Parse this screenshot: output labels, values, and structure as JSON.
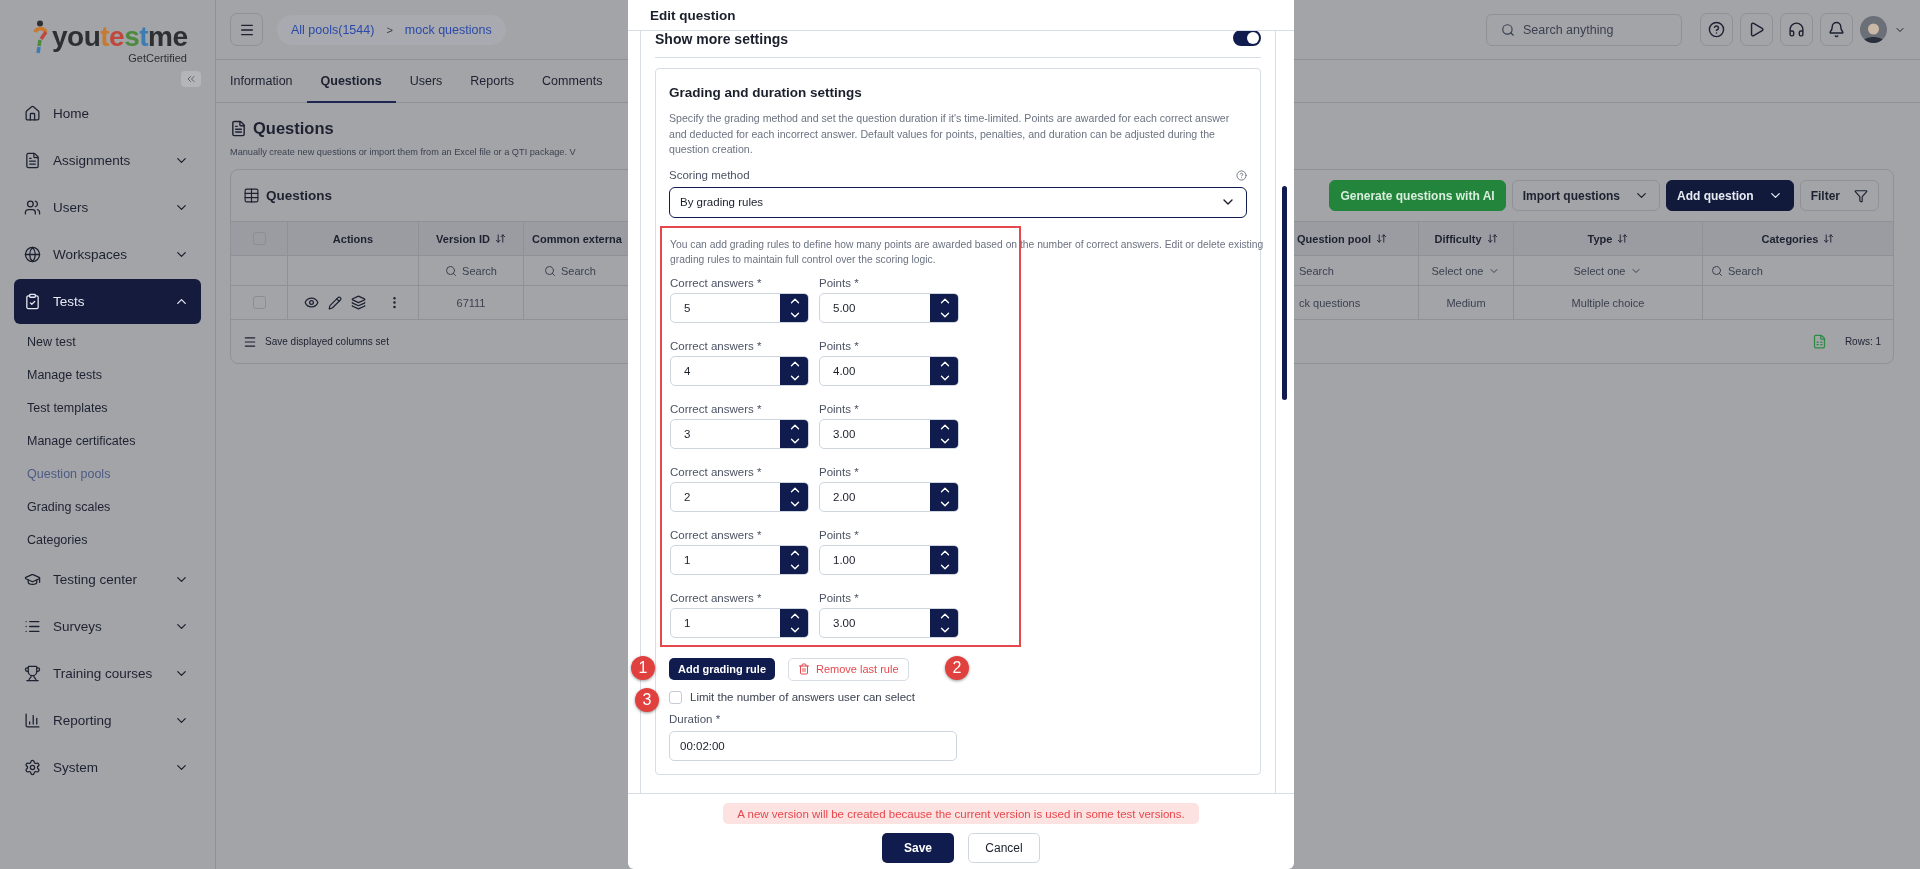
{
  "sidebar": {
    "logo": {
      "parts": [
        {
          "text": "you",
          "color": "#2e2f33"
        },
        {
          "text": "t",
          "color": "#c8782f"
        },
        {
          "text": "e",
          "color": "#c0473c"
        },
        {
          "text": "s",
          "color": "#4d8a3f"
        },
        {
          "text": "t",
          "color": "#3b7db3"
        },
        {
          "text": "me",
          "color": "#2e2f33"
        }
      ],
      "tagline": "GetCertified"
    },
    "items": [
      {
        "kind": "link",
        "label": "Home",
        "selected": false
      },
      {
        "kind": "group",
        "label": "Assignments",
        "expanded": false,
        "selected": false
      },
      {
        "kind": "group",
        "label": "Users",
        "expanded": false,
        "selected": false
      },
      {
        "kind": "group",
        "label": "Workspaces",
        "expanded": false,
        "selected": false
      },
      {
        "kind": "group",
        "label": "Tests",
        "expanded": true,
        "selected": true,
        "children": [
          {
            "label": "New test",
            "selected": false
          },
          {
            "label": "Manage tests",
            "selected": false
          },
          {
            "label": "Test templates",
            "selected": false
          },
          {
            "label": "Manage certificates",
            "selected": false
          },
          {
            "label": "Question pools",
            "selected": true
          },
          {
            "label": "Grading scales",
            "selected": false
          },
          {
            "label": "Categories",
            "selected": false
          }
        ]
      },
      {
        "kind": "group",
        "label": "Testing center",
        "expanded": false,
        "selected": false
      },
      {
        "kind": "group",
        "label": "Surveys",
        "expanded": false,
        "selected": false
      },
      {
        "kind": "group",
        "label": "Training courses",
        "expanded": false,
        "selected": false
      },
      {
        "kind": "group",
        "label": "Reporting",
        "expanded": false,
        "selected": false
      },
      {
        "kind": "group",
        "label": "System",
        "expanded": false,
        "selected": false
      }
    ]
  },
  "header": {
    "breadcrumbs": [
      "All pools(1544)",
      "mock questions"
    ],
    "separator": ">",
    "search": {
      "placeholder": "Search anything"
    }
  },
  "tabs": [
    {
      "label": "Information",
      "selected": false
    },
    {
      "label": "Questions",
      "selected": true
    },
    {
      "label": "Users",
      "selected": false
    },
    {
      "label": "Reports",
      "selected": false
    },
    {
      "label": "Comments",
      "selected": false
    }
  ],
  "page": {
    "title": "Questions",
    "description": "Manually create new questions or import them from an Excel file or a QTI package. V"
  },
  "card": {
    "title": "Questions",
    "buttons": [
      {
        "kind": "ai",
        "label": "Generate questions with AI"
      },
      {
        "kind": "dropdown",
        "label": "Import questions"
      },
      {
        "kind": "primary",
        "label": "Add question"
      },
      {
        "kind": "filter",
        "label": "Filter"
      }
    ]
  },
  "table": {
    "select_all": {
      "checked": false
    },
    "columns": [
      {
        "label": "Actions",
        "sortable": false
      },
      {
        "label": "Version ID",
        "sortable": true
      },
      {
        "label": "Common externa",
        "sortable": false
      },
      {
        "label": "Question pool",
        "sortable": true
      },
      {
        "label": "Difficulty",
        "sortable": true
      },
      {
        "label": "Type",
        "sortable": true
      },
      {
        "label": "Categories",
        "sortable": true
      }
    ],
    "filters": [
      {
        "kind": "none"
      },
      {
        "kind": "search",
        "placeholder": "Search"
      },
      {
        "kind": "search",
        "placeholder": "Search"
      },
      {
        "kind": "text",
        "placeholder": "Search"
      },
      {
        "kind": "select",
        "placeholder": "Select one"
      },
      {
        "kind": "select",
        "placeholder": "Select one"
      },
      {
        "kind": "search",
        "placeholder": "Search"
      }
    ],
    "rows": [
      {
        "checked": false,
        "version_id": "67111",
        "question_pool": "ck questions",
        "difficulty": "Medium",
        "type": "Multiple choice"
      }
    ],
    "save_columns": "Save displayed columns set",
    "row_count": "Rows: 1"
  },
  "modal": {
    "title": "Edit question",
    "show_more": {
      "label": "Show more settings",
      "on": true
    },
    "section": {
      "title": "Grading and duration settings",
      "description": "Specify the grading method and set the question duration if it's time-limited. Points are awarded for each correct answer and deducted for each incorrect answer. Default values for points, penalties, and duration can be adjusted during the question creation.",
      "scoring": {
        "label": "Scoring method",
        "value": "By grading rules"
      },
      "rules_intro": "You can add grading rules to define how many points are awarded based on the number of correct answers. Edit or delete existing grading rules to maintain full control over the scoring logic.",
      "rules": [
        {
          "correct_label": "Correct answers *",
          "correct": "5",
          "points_label": "Points *",
          "points": "5.00"
        },
        {
          "correct_label": "Correct answers *",
          "correct": "4",
          "points_label": "Points *",
          "points": "4.00"
        },
        {
          "correct_label": "Correct answers *",
          "correct": "3",
          "points_label": "Points *",
          "points": "3.00"
        },
        {
          "correct_label": "Correct answers *",
          "correct": "2",
          "points_label": "Points *",
          "points": "2.00"
        },
        {
          "correct_label": "Correct answers *",
          "correct": "1",
          "points_label": "Points *",
          "points": "1.00"
        },
        {
          "correct_label": "Correct answers *",
          "correct": "1",
          "points_label": "Points *",
          "points": "3.00"
        }
      ],
      "add_rule": "Add grading rule",
      "remove_rule": "Remove last rule",
      "limit": {
        "label": "Limit the number of answers user can select",
        "checked": false
      },
      "duration": {
        "label": "Duration *",
        "value": "00:02:00"
      }
    },
    "notice": "A new version will be created because the current version is used in some test versions.",
    "save": "Save",
    "cancel": "Cancel"
  },
  "callouts": [
    "1",
    "2",
    "3"
  ]
}
